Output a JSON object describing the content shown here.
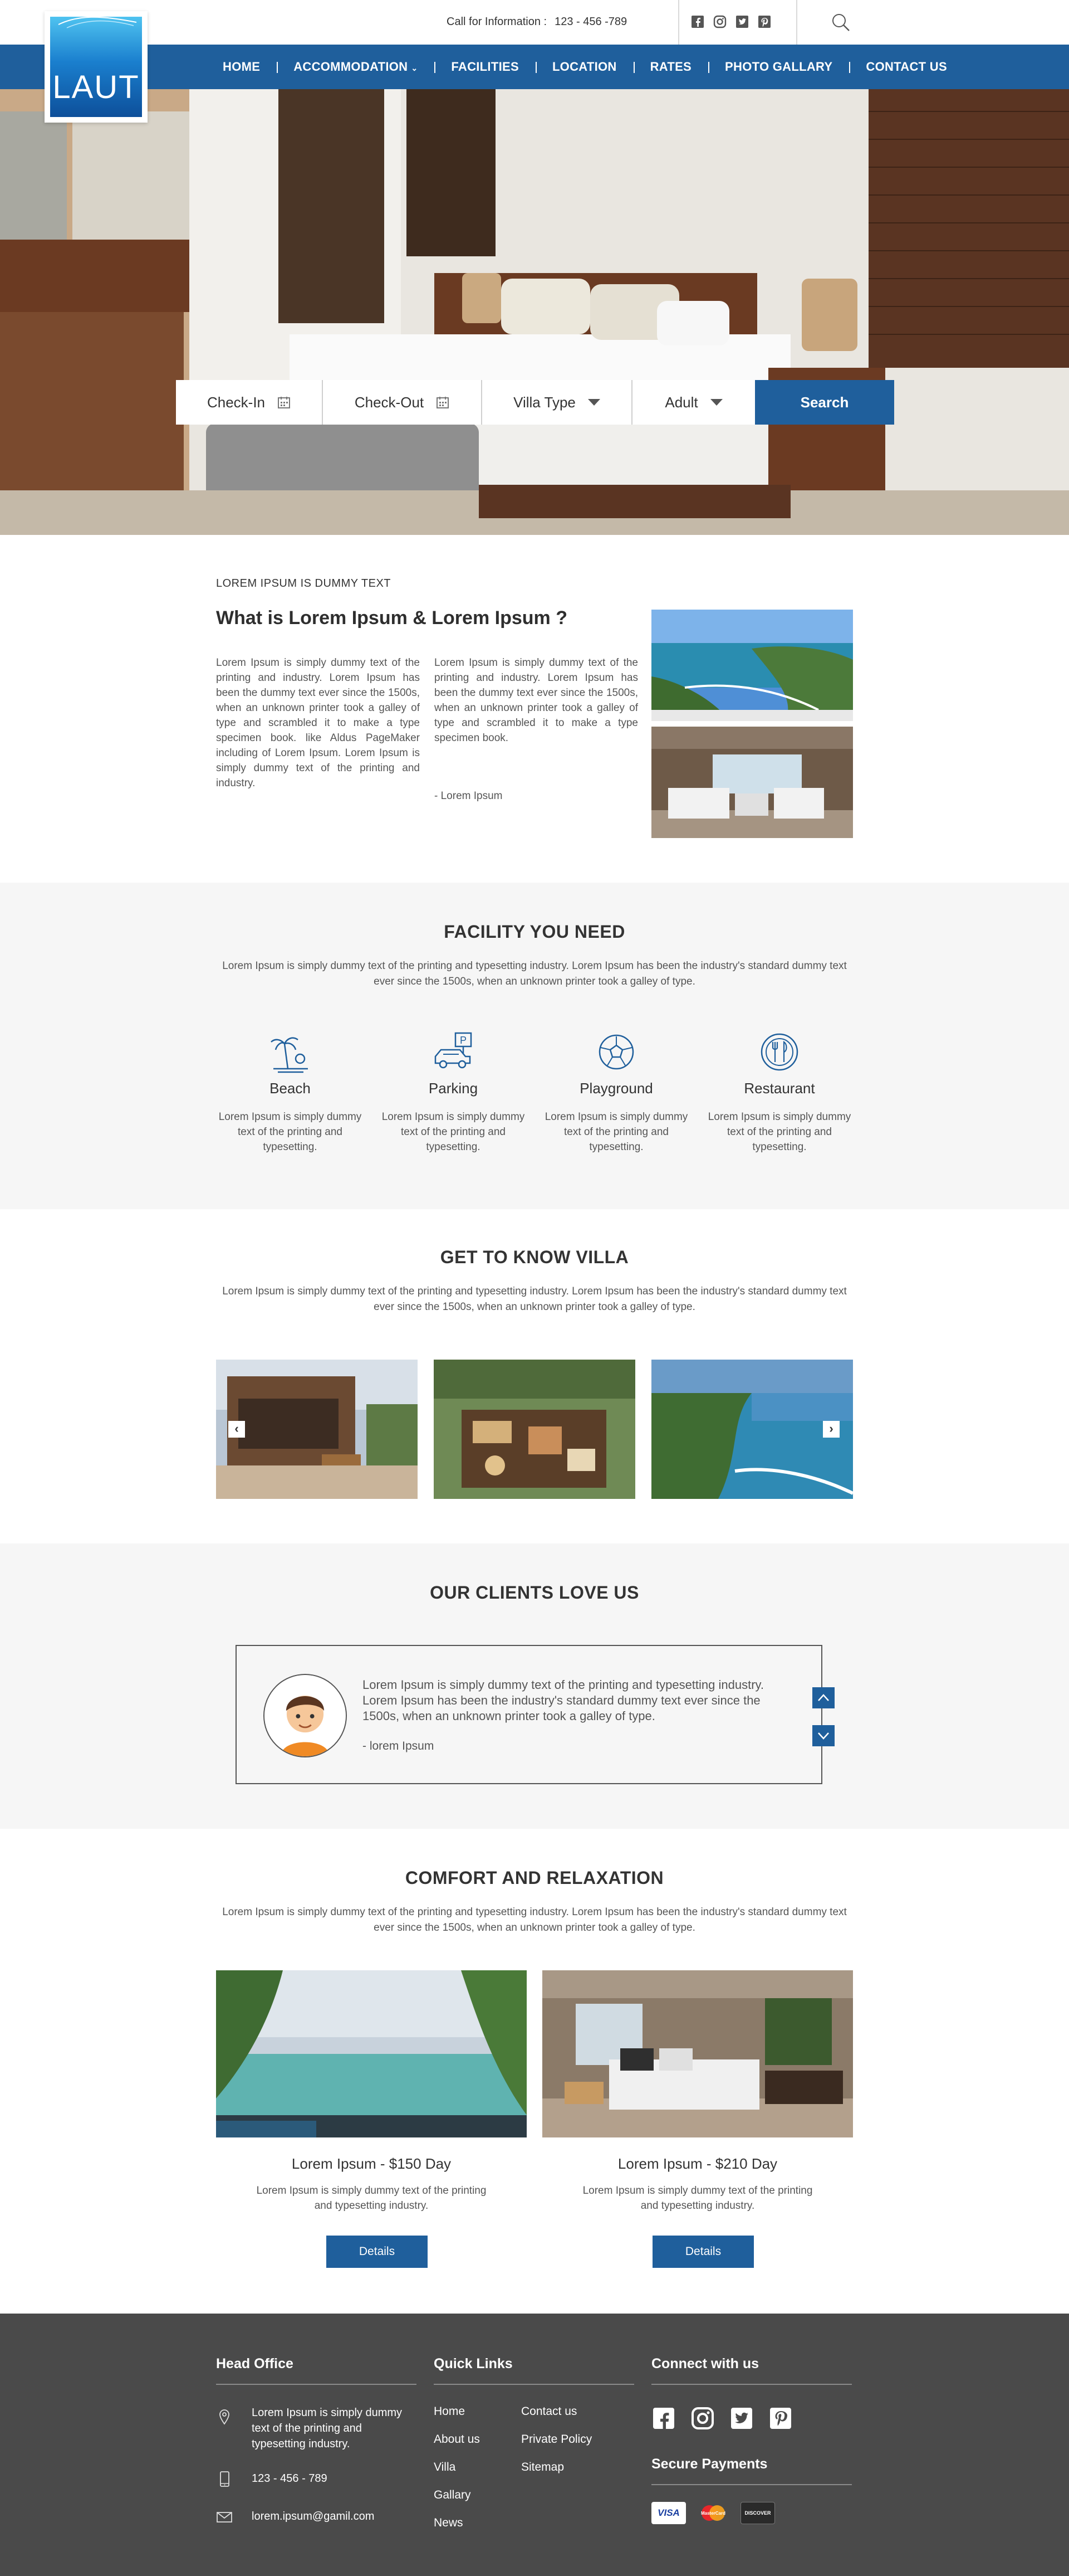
{
  "topbar": {
    "call_label": "Call for Information  :",
    "phone": "123 - 456 -789",
    "social": [
      "facebook-icon",
      "instagram-icon",
      "twitter-icon",
      "pinterest-icon"
    ]
  },
  "logo": {
    "text": "LAUT"
  },
  "nav": {
    "items": [
      "HOME",
      "ACCOMMODATION",
      "FACILITIES",
      "LOCATION",
      "RATES",
      "PHOTO GALLARY",
      "CONTACT US"
    ],
    "caret": "⌄"
  },
  "booking": {
    "checkin": "Check-In",
    "checkout": "Check-Out",
    "villa_type": "Villa Type",
    "adult": "Adult",
    "search": "Search"
  },
  "intro": {
    "kicker": "LOREM IPSUM IS DUMMY TEXT",
    "title": "What is Lorem Ipsum & Lorem Ipsum ?",
    "col1": "Lorem Ipsum is simply dummy text of the printing and industry. Lorem Ipsum has been the dummy text ever since the 1500s, when an unknown printer took a galley of type and scrambled it to make a type specimen book. like Aldus PageMaker including of Lorem Ipsum. Lorem Ipsum is simply dummy text of the printing and industry.",
    "col2": "Lorem Ipsum is simply dummy text of the printing and industry. Lorem Ipsum has been the dummy text ever since the 1500s, when an unknown printer took a galley of type and scrambled it to make a type specimen book.",
    "signature": "- Lorem Ipsum"
  },
  "facility": {
    "title": "FACILITY YOU NEED",
    "desc": "Lorem Ipsum is simply dummy text of the printing and typesetting industry. Lorem Ipsum has been the industry's standard dummy text ever since the 1500s, when an unknown printer took a galley of type.",
    "items": [
      {
        "name": "Beach",
        "icon": "beach-icon",
        "text": "Lorem Ipsum is simply dummy text of the printing and typesetting."
      },
      {
        "name": "Parking",
        "icon": "parking-icon",
        "text": "Lorem Ipsum is simply dummy text of the printing and typesetting."
      },
      {
        "name": "Playground",
        "icon": "playground-icon",
        "text": "Lorem Ipsum is simply dummy text of the printing and typesetting."
      },
      {
        "name": "Restaurant",
        "icon": "restaurant-icon",
        "text": "Lorem Ipsum is simply dummy text of the printing and typesetting."
      }
    ]
  },
  "villa": {
    "title": "GET TO KNOW VILLA",
    "desc": "Lorem Ipsum is simply dummy text of the printing and typesetting industry. Lorem Ipsum has been the industry's standard dummy text ever since the 1500s, when an unknown printer took a galley of type.",
    "prev": "‹",
    "next": "›"
  },
  "clients": {
    "title": "OUR CLIENTS LOVE US",
    "quote": "Lorem Ipsum is simply dummy text of the printing and typesetting industry. Lorem Ipsum has been the industry's standard dummy text ever since the 1500s, when an unknown printer took a galley of type.",
    "author": "- lorem Ipsum"
  },
  "comfort": {
    "title": "COMFORT AND RELAXATION",
    "desc": "Lorem Ipsum is simply dummy text of the printing and typesetting industry. Lorem Ipsum has been the industry's standard dummy text ever since the 1500s, when an unknown printer took a galley of type.",
    "rooms": [
      {
        "name": "Lorem Ipsum - $150 Day",
        "text": "Lorem Ipsum is simply dummy text of the printing and typesetting industry.",
        "button": "Details"
      },
      {
        "name": "Lorem Ipsum - $210 Day",
        "text": "Lorem Ipsum is simply dummy text of the printing and typesetting industry.",
        "button": "Details"
      }
    ]
  },
  "footer": {
    "head_office": {
      "title": "Head Office",
      "address": "Lorem Ipsum is simply dummy text of the printing and typesetting industry.",
      "phone": "123 - 456 - 789",
      "email": "lorem.ipsum@gamil.com"
    },
    "quick_links": {
      "title": "Quick Links",
      "col1": [
        "Home",
        "About us",
        "Villa",
        "Gallary",
        "News"
      ],
      "col2": [
        "Contact us",
        "Private Policy",
        "Sitemap"
      ]
    },
    "connect": {
      "title": "Connect with us",
      "social": [
        "facebook-icon",
        "instagram-icon",
        "twitter-icon",
        "pinterest-icon"
      ]
    },
    "payments": {
      "title": "Secure Payments",
      "cards": [
        "VISA",
        "MasterCard",
        "DISCOVER"
      ]
    }
  },
  "colors": {
    "brand": "#1f5f9c",
    "footer": "#4a4a4a",
    "section_grey": "#f6f6f6"
  }
}
